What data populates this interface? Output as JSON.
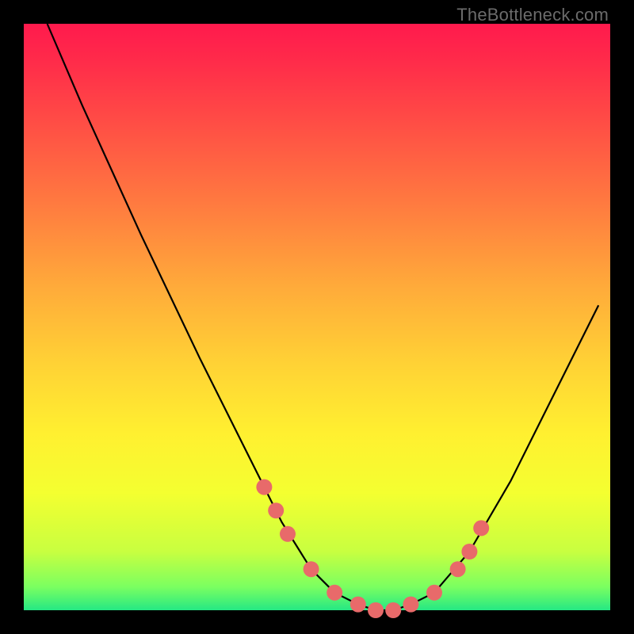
{
  "watermark": "TheBottleneck.com",
  "chart_data": {
    "type": "line",
    "title": "",
    "xlabel": "",
    "ylabel": "",
    "xlim": [
      0,
      100
    ],
    "ylim": [
      0,
      100
    ],
    "grid": false,
    "series": [
      {
        "name": "curve",
        "stroke": "#000000",
        "x": [
          4,
          10,
          20,
          30,
          38,
          44,
          49,
          53,
          57,
          60,
          63,
          66,
          70,
          76,
          83,
          90,
          98
        ],
        "values": [
          100,
          86,
          64,
          43,
          27,
          15,
          7,
          3,
          1,
          0,
          0,
          1,
          3,
          10,
          22,
          36,
          52
        ]
      }
    ],
    "markers": {
      "name": "dots",
      "color": "#e86a6a",
      "radius": 10,
      "x": [
        41,
        43,
        45,
        49,
        53,
        57,
        60,
        63,
        66,
        70,
        74,
        76,
        78
      ],
      "values": [
        21,
        17,
        13,
        7,
        3,
        1,
        0,
        0,
        1,
        3,
        7,
        10,
        14
      ]
    }
  }
}
